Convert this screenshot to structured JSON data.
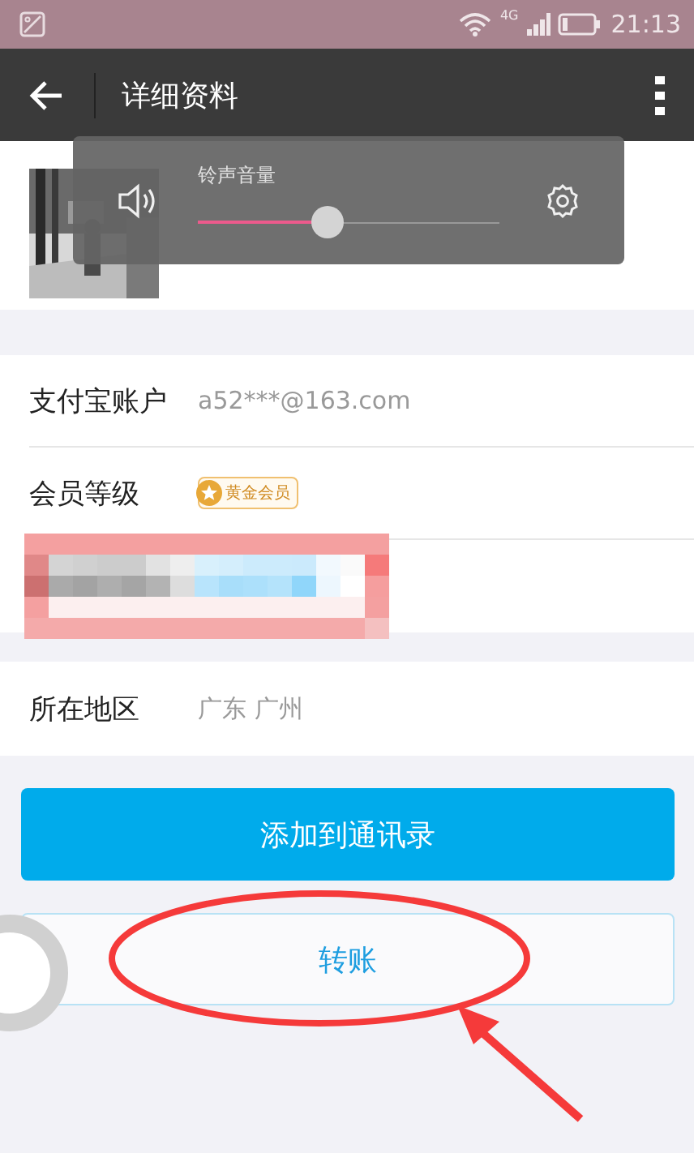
{
  "status_bar": {
    "network": "4G",
    "time": "21:13"
  },
  "toolbar": {
    "title": "详细资料"
  },
  "volume_popup": {
    "label": "铃声音量",
    "level": 0.43
  },
  "fields": [
    {
      "kind": "text",
      "label": "支付宝账户",
      "value": "a52***@163.com"
    },
    {
      "kind": "badge",
      "label": "会员等级",
      "value": "黄金会员"
    }
  ],
  "location": {
    "label": "所在地区",
    "value": "广东 广州"
  },
  "buttons": [
    {
      "kind": "primary",
      "label": "添加到通讯录"
    },
    {
      "kind": "secondary",
      "label": "转账"
    }
  ]
}
